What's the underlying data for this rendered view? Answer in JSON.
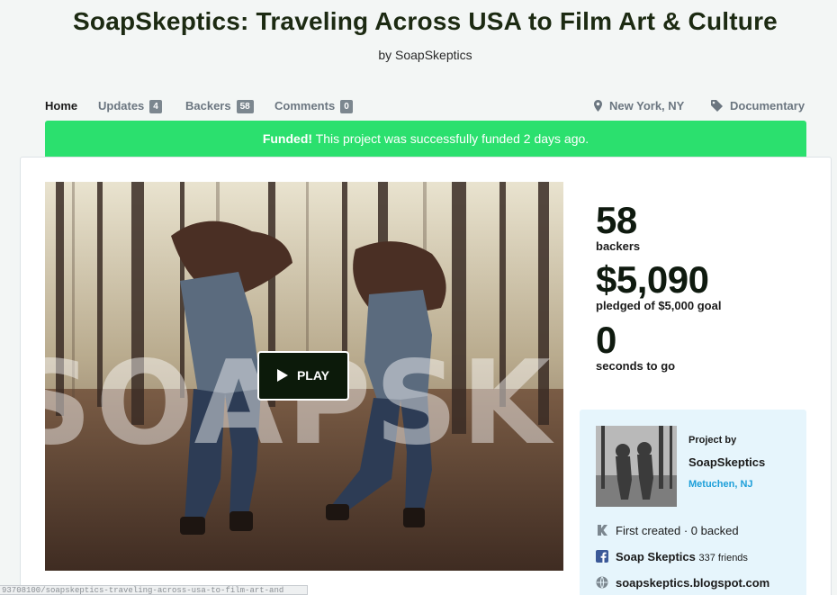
{
  "project": {
    "title": "SoapSkeptics: Traveling Across USA to Film Art & Culture",
    "byline": "by SoapSkeptics"
  },
  "nav": {
    "home": "Home",
    "updates": {
      "label": "Updates",
      "count": "4"
    },
    "backers": {
      "label": "Backers",
      "count": "58"
    },
    "comments": {
      "label": "Comments",
      "count": "0"
    },
    "location": "New York, NY",
    "category": "Documentary"
  },
  "banner": {
    "strong": "Funded!",
    "text": " This project was successfully funded 2 days ago.",
    "color": "#2be06e"
  },
  "video": {
    "play_label": "PLAY",
    "watermark": "SOAPSKEPTIC"
  },
  "stats": {
    "backers_value": "58",
    "backers_label": "backers",
    "pledged_value": "$5,090",
    "pledged_label": "pledged of $5,000 goal",
    "time_value": "0",
    "time_label": "seconds to go"
  },
  "creator": {
    "project_by": "Project by",
    "name": "SoapSkeptics",
    "location": "Metuchen, NJ",
    "history": "First created · 0 backed",
    "facebook_name": "Soap Skeptics",
    "facebook_friends": "337 friends",
    "website": "soapskeptics.blogspot.com",
    "link_color": "#1d9fd9"
  },
  "statusbar": {
    "url": "93708100/soapskeptics-traveling-across-usa-to-film-art-and"
  }
}
